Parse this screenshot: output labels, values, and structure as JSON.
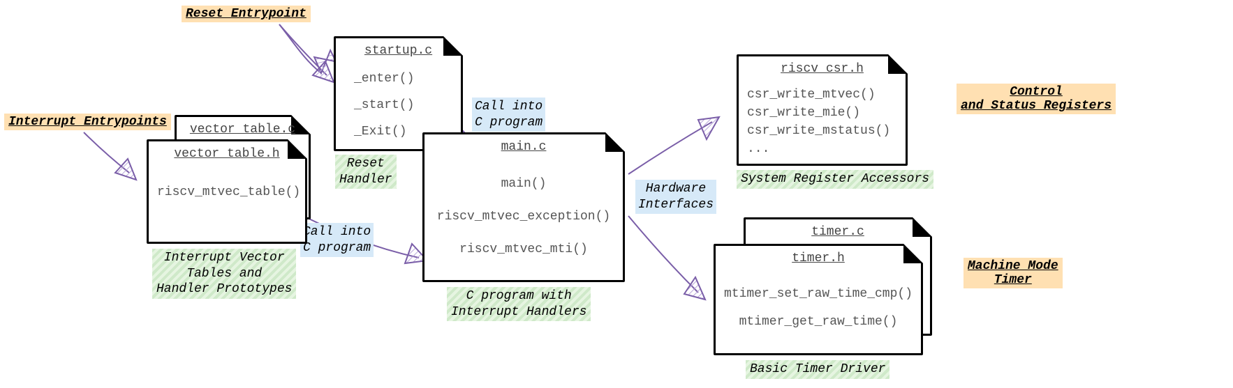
{
  "labels": {
    "reset_entrypoint": "Reset Entrypoint",
    "interrupt_entrypoints": "Interrupt Entrypoints",
    "control_status": "Control\nand Status Registers",
    "machine_mode_timer": "Machine Mode\nTimer",
    "reset_handler": "Reset\nHandler",
    "interrupt_vector_caption": "Interrupt Vector\nTables and\nHandler Prototypes",
    "c_program_caption": "C program with\nInterrupt Handlers",
    "system_register_accessors": "System Register Accessors",
    "basic_timer_driver": "Basic Timer Driver",
    "call_into_c_1": "Call into\nC program",
    "call_into_c_2": "Call into\nC program",
    "hardware_interfaces": "Hardware\nInterfaces"
  },
  "files": {
    "vector_table_c": {
      "title": "vector_table.c",
      "content": ""
    },
    "vector_table_h": {
      "title": "vector_table.h",
      "content": "riscv_mtvec_table()"
    },
    "startup_c": {
      "title": "startup.c",
      "content": "_enter()\n_start()\n_Exit()"
    },
    "main_c": {
      "title": "main.c",
      "content": "main()\nriscv_mtvec_exception()\nriscv_mtvec_mti()"
    },
    "riscv_csr_h": {
      "title": "riscv_csr.h",
      "content": "csr_write_mtvec()\ncsr_write_mie()\ncsr_write_mstatus()\n..."
    },
    "timer_c": {
      "title": "timer.c",
      "content": ""
    },
    "timer_h": {
      "title": "timer.h",
      "content": "mtimer_set_raw_time_cmp()\nmtimer_get_raw_time()"
    }
  }
}
